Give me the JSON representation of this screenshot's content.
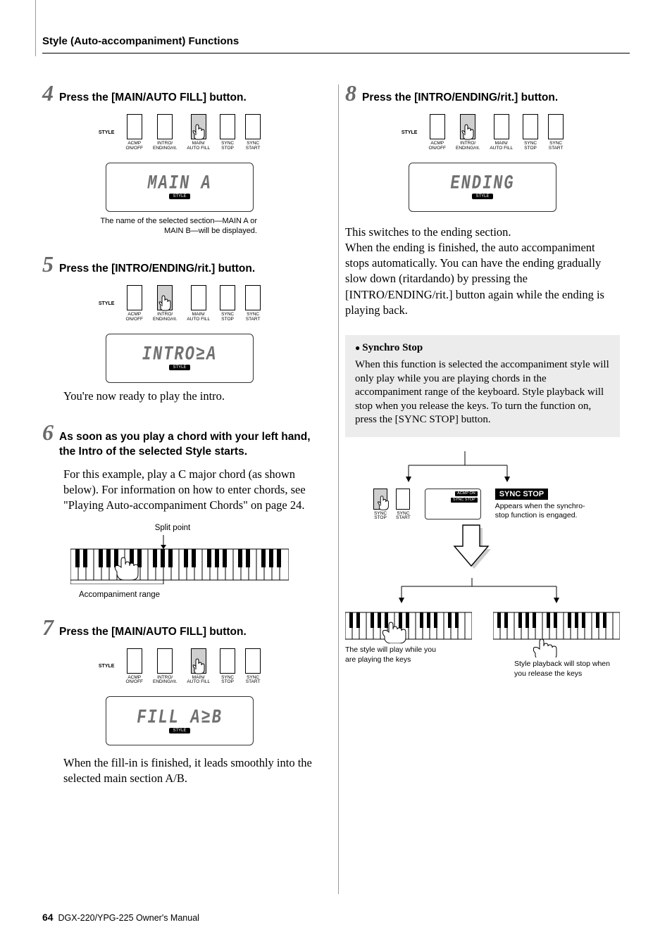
{
  "header": {
    "section_title": "Style (Auto-accompaniment) Functions"
  },
  "panel": {
    "style_label": "STYLE",
    "btn1": "ACMP\nON/OFF",
    "btn2": "INTRO/\nENDING/rit.",
    "btn3": "MAIN/\nAUTO FILL",
    "btn4": "SYNC\nSTOP",
    "btn5": "SYNC\nSTART",
    "lcd_badge": "STYLE"
  },
  "steps": {
    "s4": {
      "num": "4",
      "title": "Press the [MAIN/AUTO FILL] button.",
      "lcd": "MAIN A",
      "note": "The name of the selected section—MAIN A or MAIN B—will be displayed."
    },
    "s5": {
      "num": "5",
      "title": "Press the [INTRO/ENDING/rit.] button.",
      "lcd": "INTRO≥A",
      "body": "You're now ready to play the intro."
    },
    "s6": {
      "num": "6",
      "title": "As soon as you play a chord with your left hand, the Intro of the selected Style starts.",
      "body": "For this example, play a C major chord (as shown below). For information on how to enter chords, see \"Playing Auto-accompaniment Chords\" on page 24.",
      "split_label": "Split point",
      "accomp_label": "Accompaniment range"
    },
    "s7": {
      "num": "7",
      "title": "Press the [MAIN/AUTO FILL] button.",
      "lcd": "FILL A≥B",
      "body": "When the fill-in is finished, it leads smoothly into the selected main section A/B."
    },
    "s8": {
      "num": "8",
      "title": "Press the [INTRO/ENDING/rit.] button.",
      "lcd": "ENDING",
      "body": "This switches to the ending section.\nWhen the ending is finished, the auto accompaniment stops automatically. You can have the ending gradually slow down (ritardando) by pressing the [INTRO/ENDING/rit.] button again while the ending is playing back."
    }
  },
  "synchro": {
    "title": "Synchro Stop",
    "body": "When this function is selected the accompaniment style will only play while you are playing chords in the accompaniment range of the keyboard. Style playback will stop when you release the keys. To turn the function on, press the [SYNC STOP] button.",
    "badge": "SYNC STOP",
    "lcd_line1": "ACMP ON",
    "lcd_line2": "SYNC STOP",
    "note_right": "Appears when the synchro-stop function is engaged.",
    "kb_left_caption": "The style will play while you are playing the keys",
    "kb_right_caption": "Style playback will stop when you release the keys"
  },
  "footer": {
    "page": "64",
    "text": "DGX-220/YPG-225  Owner's Manual"
  }
}
